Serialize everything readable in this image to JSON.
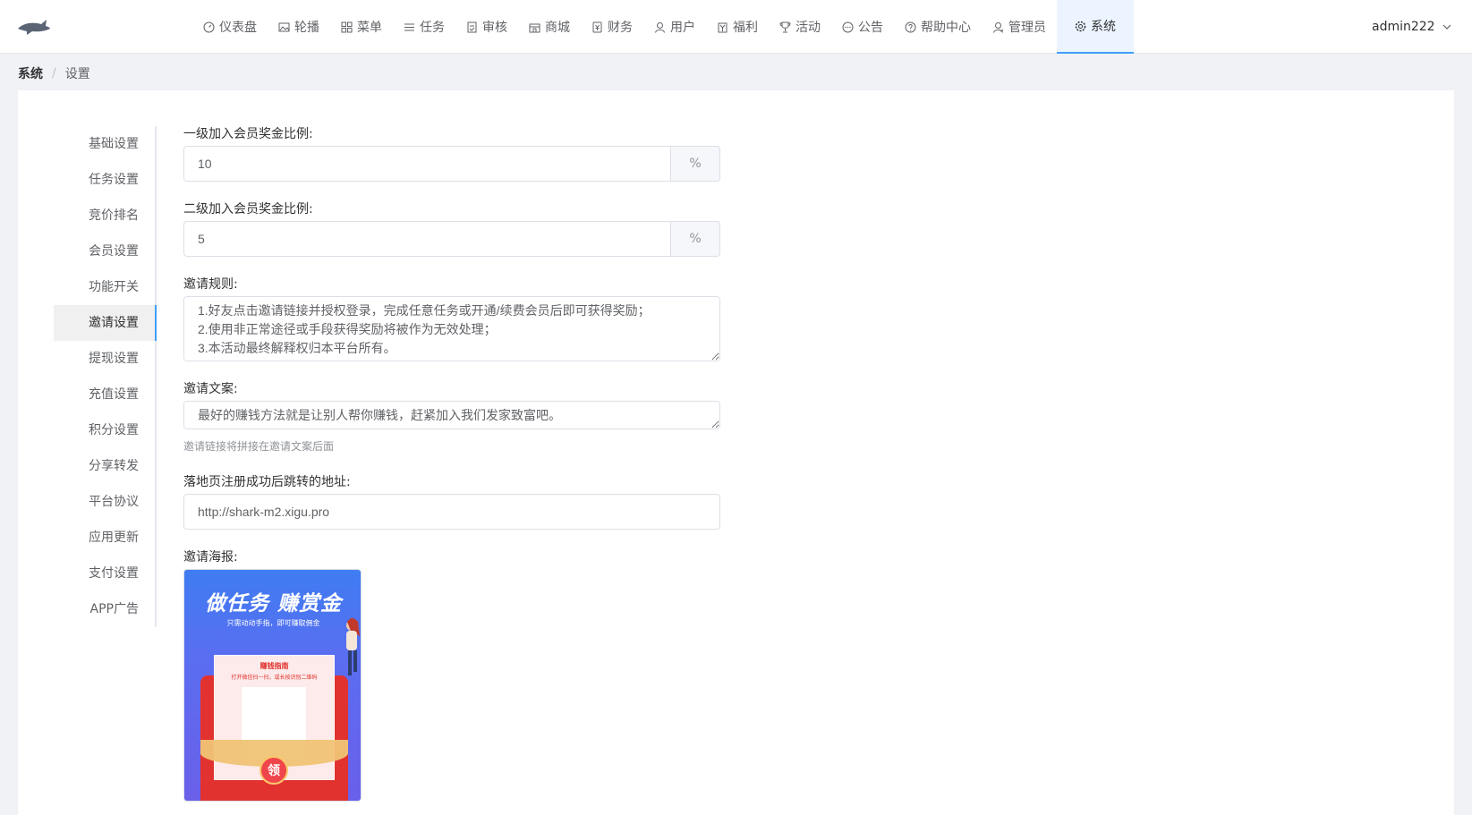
{
  "nav": {
    "items": [
      {
        "label": "仪表盘",
        "icon": "dashboard-icon"
      },
      {
        "label": "轮播",
        "icon": "image-icon"
      },
      {
        "label": "菜单",
        "icon": "grid-icon"
      },
      {
        "label": "任务",
        "icon": "list-icon"
      },
      {
        "label": "审核",
        "icon": "document-check-icon"
      },
      {
        "label": "商城",
        "icon": "shop-icon"
      },
      {
        "label": "财务",
        "icon": "finance-icon"
      },
      {
        "label": "用户",
        "icon": "user-icon"
      },
      {
        "label": "福利",
        "icon": "gift-icon"
      },
      {
        "label": "活动",
        "icon": "trophy-icon"
      },
      {
        "label": "公告",
        "icon": "chat-bubble-icon"
      },
      {
        "label": "帮助中心",
        "icon": "question-icon"
      },
      {
        "label": "管理员",
        "icon": "admin-icon"
      }
    ],
    "active": {
      "label": "系统",
      "icon": "gear-icon"
    },
    "user": "admin222"
  },
  "breadcrumb": {
    "root": "系统",
    "sep": "/",
    "current": "设置"
  },
  "side_menu": [
    "基础设置",
    "任务设置",
    "竞价排名",
    "会员设置",
    "功能开关",
    "邀请设置",
    "提现设置",
    "充值设置",
    "积分设置",
    "分享转发",
    "平台协议",
    "应用更新",
    "支付设置",
    "APP广告"
  ],
  "active_side_index": 5,
  "form": {
    "level1_label": "一级加入会员奖金比例:",
    "level1_value": "10",
    "level2_label": "二级加入会员奖金比例:",
    "level2_value": "5",
    "percent": "%",
    "rules_label": "邀请规则:",
    "rules_value": "1.好友点击邀请链接并授权登录，完成任意任务或开通/续费会员后即可获得奖励；\n2.使用非正常途径或手段获得奖励将被作为无效处理；\n3.本活动最终解释权归本平台所有。",
    "copy_label": "邀请文案:",
    "copy_value": "最好的赚钱方法就是让别人帮你赚钱，赶紧加入我们发家致富吧。",
    "copy_tip": "邀请链接将拼接在邀请文案后面",
    "url_label": "落地页注册成功后跳转的地址:",
    "url_value": "http://shark-m2.xigu.pro",
    "poster_label": "邀请海报:"
  },
  "poster": {
    "title": "做任务 赚赏金",
    "subtitle": "只需动动手指，即可赚取佣金",
    "card_title": "赚钱指南",
    "card_text": "打开微信扫一扫，或长按识别二维码",
    "coin": "领"
  }
}
